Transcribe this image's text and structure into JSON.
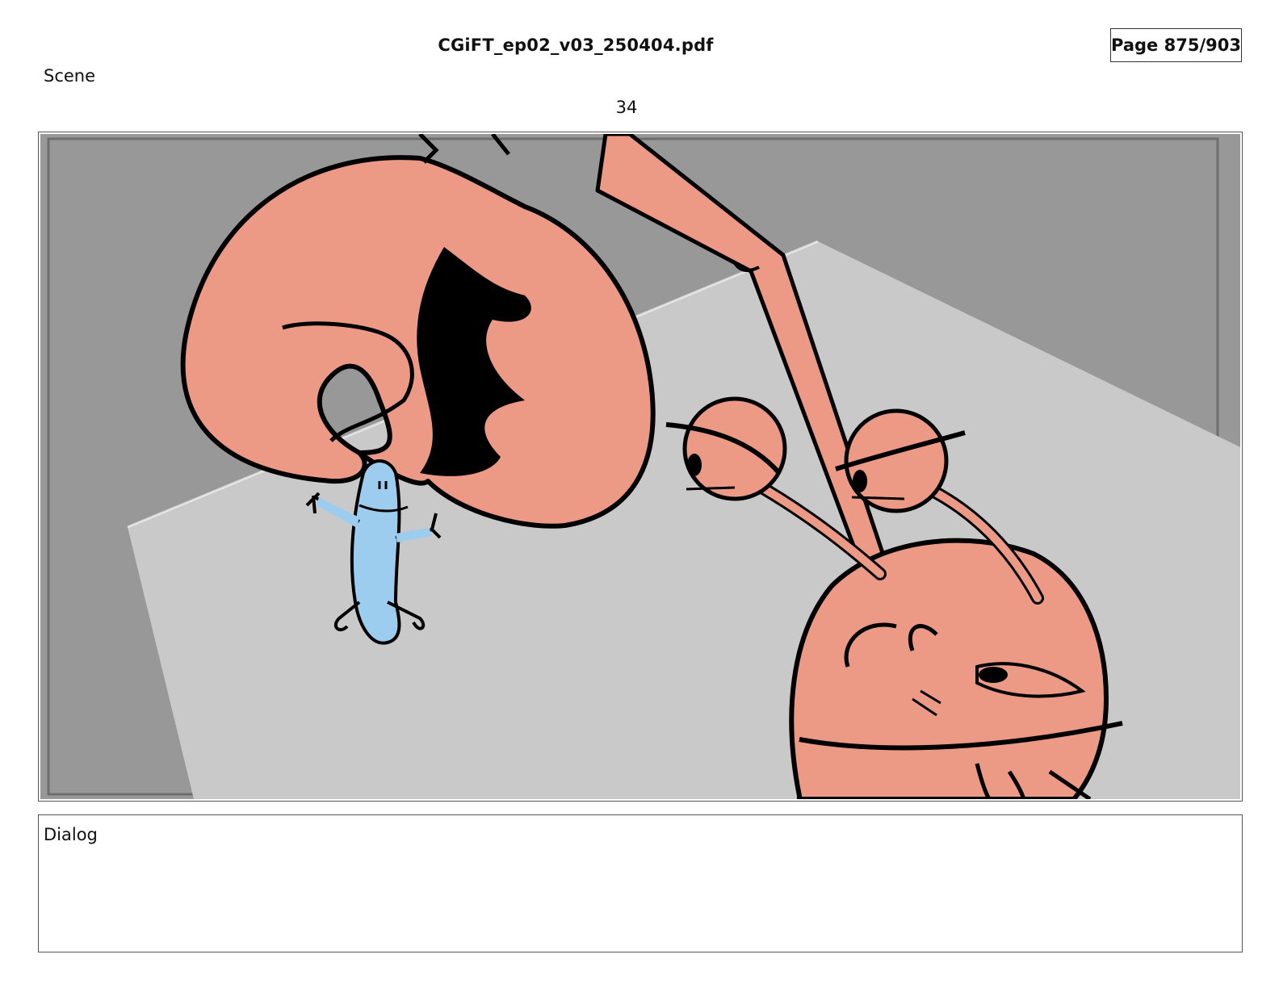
{
  "header": {
    "file_title": "CGiFT_ep02_v03_250404.pdf",
    "page_indicator": "Page 875/903"
  },
  "scene": {
    "label": "Scene",
    "number": "34"
  },
  "panel": {
    "colors": {
      "background_dark": "#989898",
      "floor": "#c9c9c9",
      "crab": "#ec9a86",
      "fish": "#9dcdee",
      "ink": "#000000"
    }
  },
  "dialog": {
    "label": "Dialog"
  }
}
